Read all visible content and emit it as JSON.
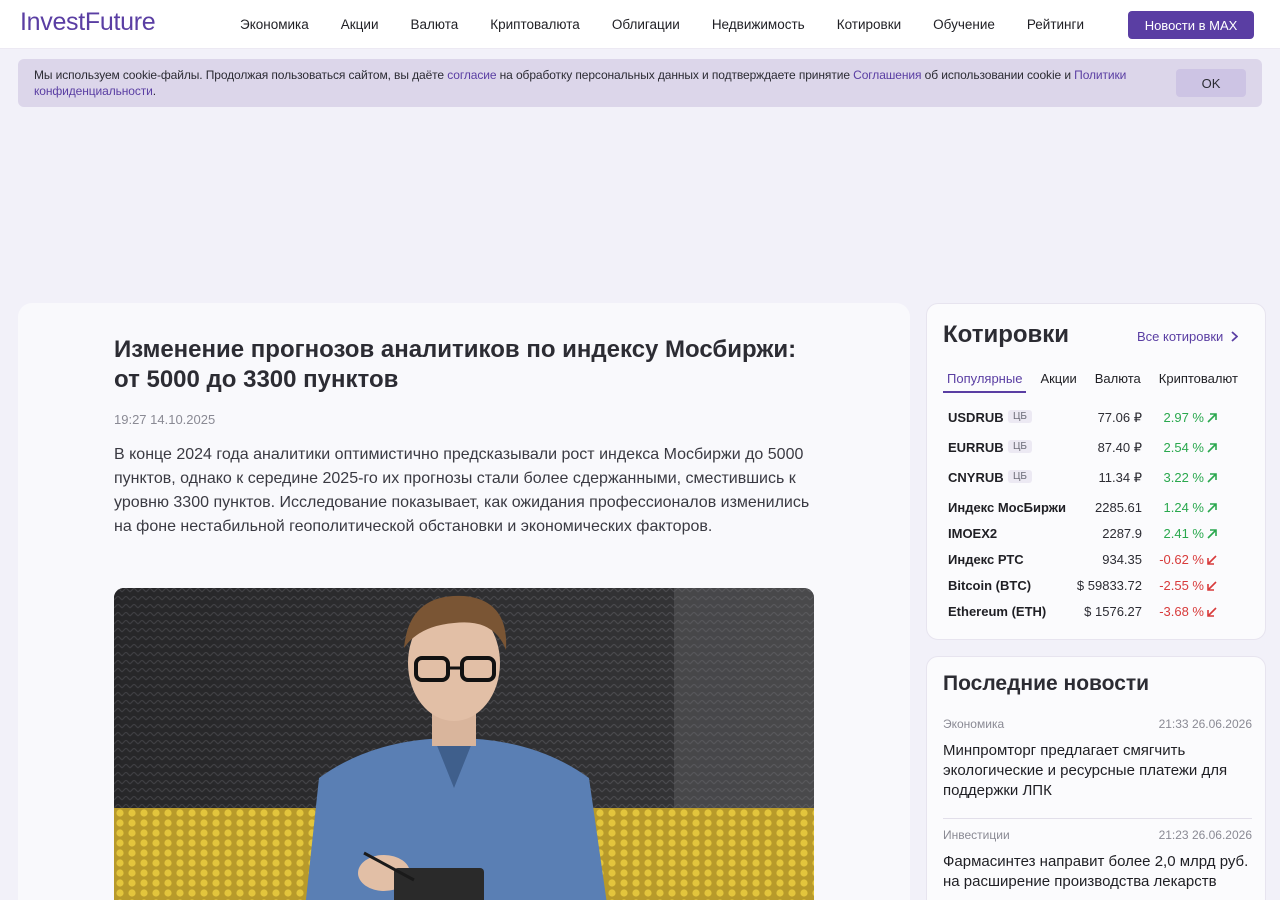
{
  "header": {
    "logo": "InvestFuture",
    "nav": [
      "Экономика",
      "Акции",
      "Валюта",
      "Криптовалюта",
      "Облигации",
      "Недвижимость",
      "Котировки",
      "Обучение",
      "Рейтинги"
    ],
    "max_button": "Новости в MAX"
  },
  "cookie": {
    "text_1": "Мы используем cookie-файлы. Продолжая пользоваться сайтом, вы даёте ",
    "link_1": "согласие",
    "text_2": " на обработку персональных данных и подтверждаете принятие ",
    "link_2": "Соглашения",
    "text_3": " об использовании cookie и ",
    "link_3": "Политики конфиденциальности",
    "text_4": ".",
    "ok": "OK"
  },
  "article": {
    "title": "Изменение прогнозов аналитиков по индексу Мосбиржи: от 5000 до 3300 пунктов",
    "datetime": "19:27 14.10.2025",
    "lead": "В конце 2024 года аналитики оптимистично предсказывали рост индекса Мосбиржи до 5000 пунктов, однако к середине 2025-го их прогнозы стали более сдержанными, сместившись к уровню 3300 пунктов. Исследование показывает, как ожидания профессионалов изменились на фоне нестабильной геополитической обстановки и экономических факторов."
  },
  "quotes": {
    "title": "Котировки",
    "all_link": "Все котировки",
    "tabs": [
      "Популярные",
      "Акции",
      "Валюта",
      "Криптовалют"
    ],
    "rows": [
      {
        "name": "USDRUB",
        "cb": "ЦБ",
        "price": "77.06 ₽",
        "change": "2.97 %",
        "dir": "up"
      },
      {
        "name": "EURRUB",
        "cb": "ЦБ",
        "price": "87.40 ₽",
        "change": "2.54 %",
        "dir": "up"
      },
      {
        "name": "CNYRUB",
        "cb": "ЦБ",
        "price": "11.34 ₽",
        "change": "3.22 %",
        "dir": "up"
      },
      {
        "name": "Индекс МосБиржи",
        "cb": "",
        "price": "2285.61",
        "change": "1.24 %",
        "dir": "up"
      },
      {
        "name": "IMOEX2",
        "cb": "",
        "price": "2287.9",
        "change": "2.41 %",
        "dir": "up"
      },
      {
        "name": "Индекс РТС",
        "cb": "",
        "price": "934.35",
        "change": "-0.62 %",
        "dir": "down"
      },
      {
        "name": "Bitcoin (BTC)",
        "cb": "",
        "price": "$ 59833.72",
        "change": "-2.55 %",
        "dir": "down"
      },
      {
        "name": "Ethereum (ETH)",
        "cb": "",
        "price": "$ 1576.27",
        "change": "-3.68 %",
        "dir": "down"
      }
    ]
  },
  "news": {
    "title": "Последние новости",
    "items": [
      {
        "category": "Экономика",
        "time": "21:33 26.06.2026",
        "headline": "Минпромторг предлагает смягчить экологические и ресурсные платежи для поддержки ЛПК"
      },
      {
        "category": "Инвестиции",
        "time": "21:23 26.06.2026",
        "headline": "Фармасинтез направит более 2,0 млрд руб. на расширение производства лекарств"
      }
    ]
  },
  "colors": {
    "accent": "#5a3ea3",
    "up": "#2aa84e",
    "down": "#d83b3b",
    "page_bg": "#f2f1f9"
  },
  "icons": {
    "chevron": "chevron-right-icon",
    "up_arrow": "arrow-up-right-icon",
    "down_arrow": "arrow-down-left-icon"
  }
}
